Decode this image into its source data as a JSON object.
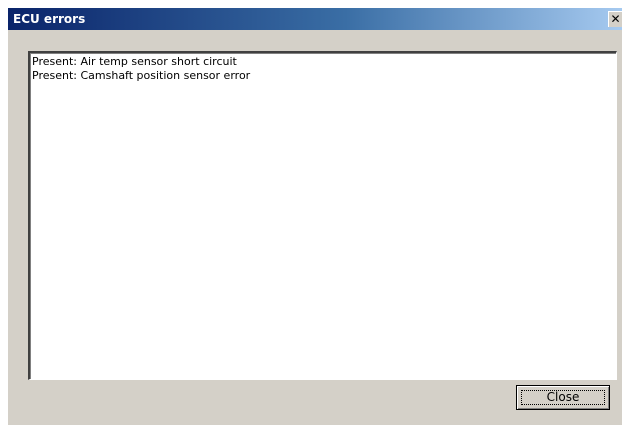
{
  "window": {
    "title": "ECU errors",
    "close_glyph": "✕"
  },
  "errors": {
    "items": [
      "Present: Air temp sensor short circuit",
      "Present: Camshaft position sensor error"
    ]
  },
  "buttons": {
    "close_label": "Close"
  },
  "colors": {
    "titlebar_start": "#0a246a",
    "titlebar_end": "#a6caf0",
    "dialog_face": "#d4d0c8"
  }
}
